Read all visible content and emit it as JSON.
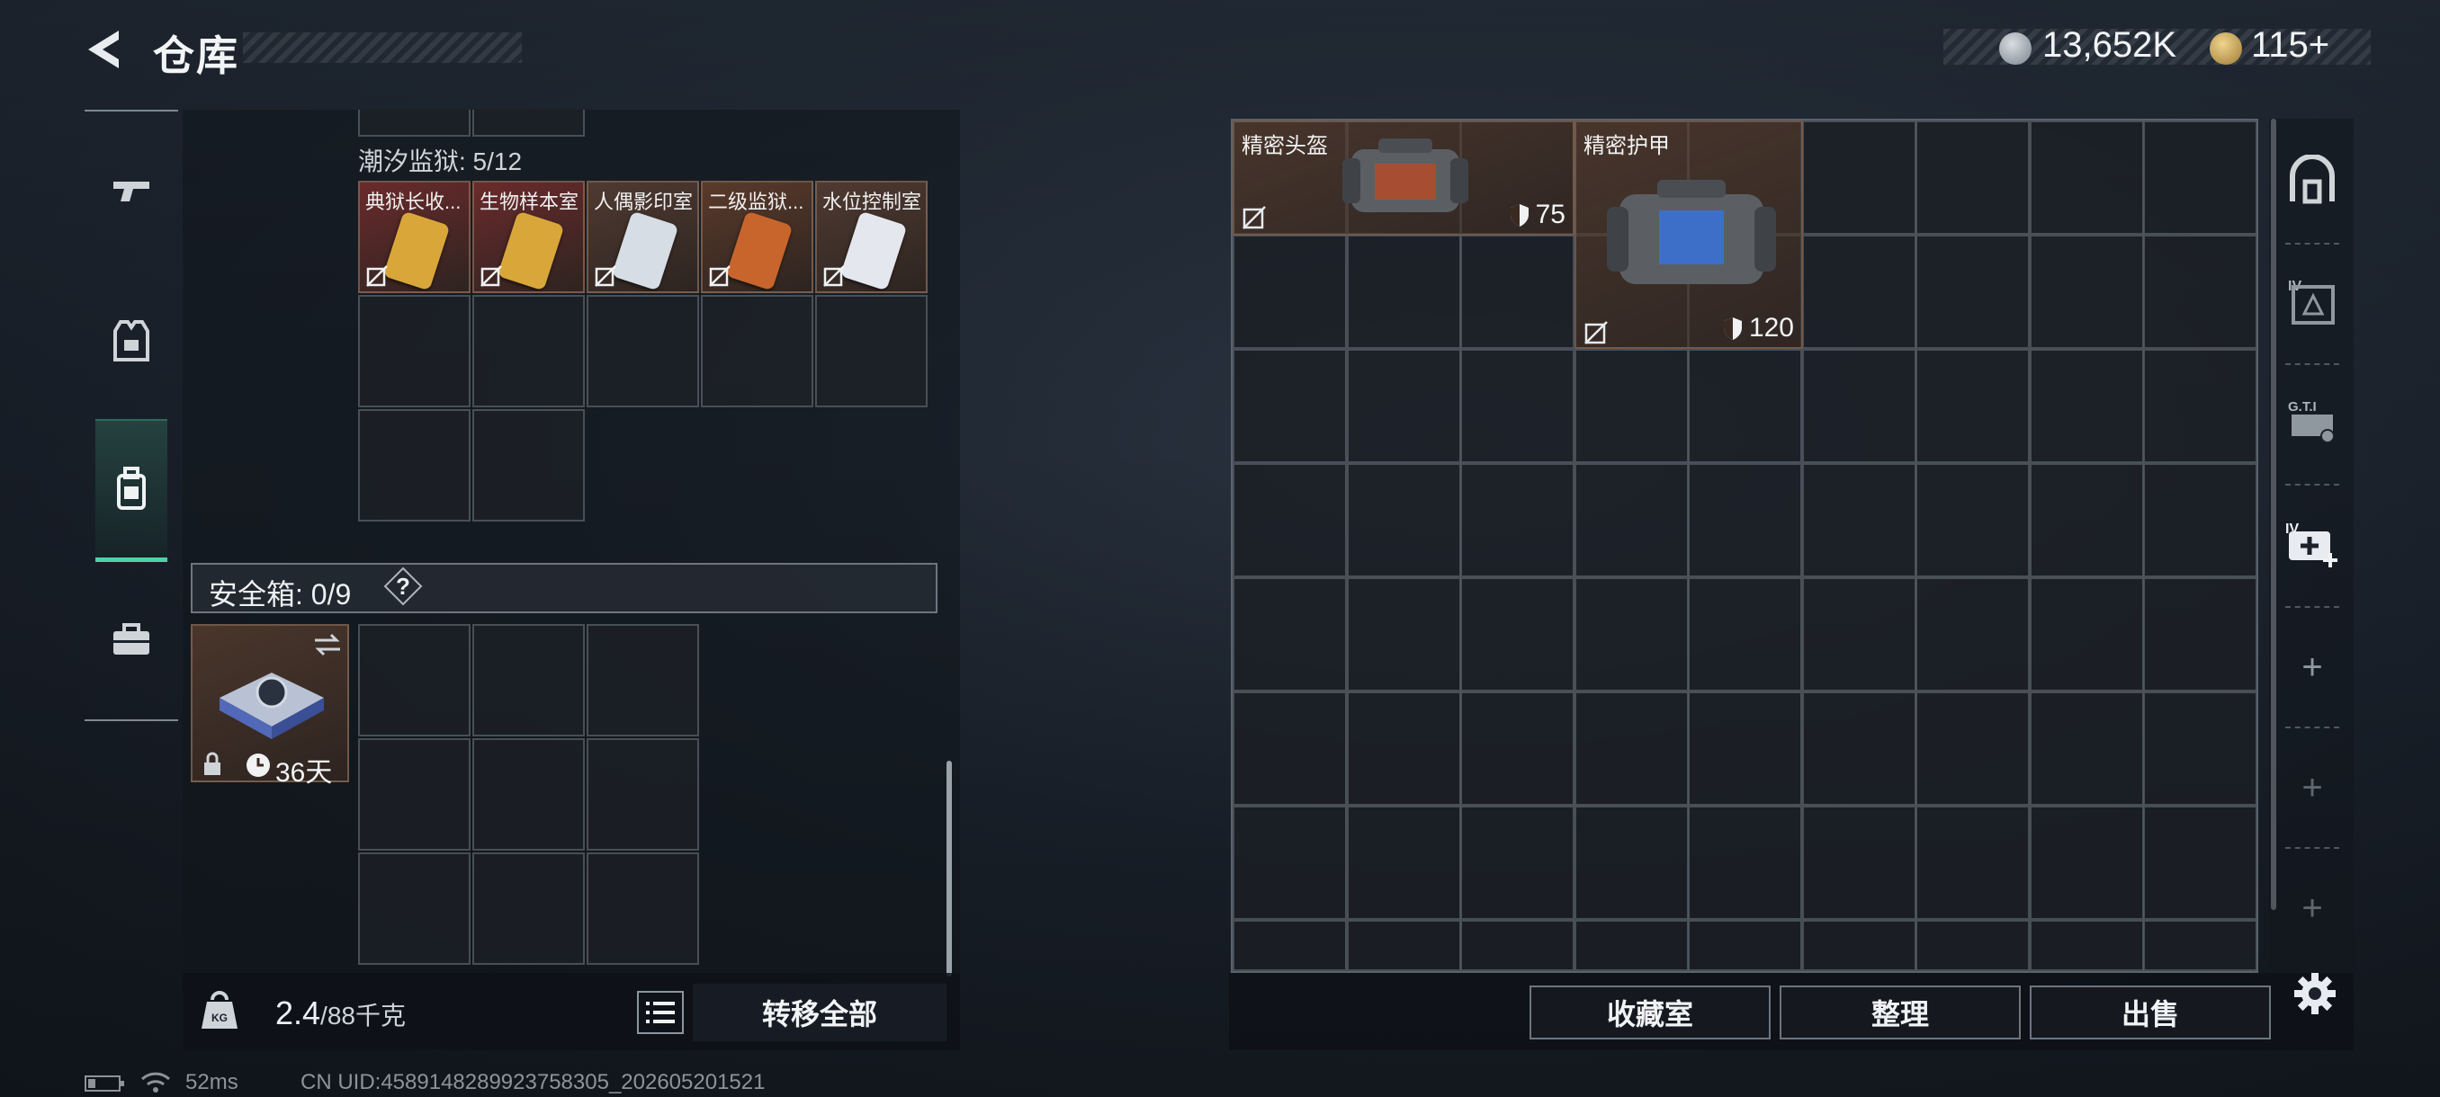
{
  "header": {
    "title": "仓库"
  },
  "currencies": [
    {
      "icon": "silver-coin-icon",
      "value": "13,652K"
    },
    {
      "icon": "gold-coin-icon",
      "value": "115+"
    }
  ],
  "left": {
    "section_label": "潮汐监狱: 5/12",
    "keycards": [
      {
        "name": "典狱长收...",
        "bg": "#6b2a2c",
        "card": "#d9a63a"
      },
      {
        "name": "生物样本室",
        "bg": "#6b2a2c",
        "card": "#d9a63a"
      },
      {
        "name": "人偶影印室",
        "bg": "#4f3a32",
        "card": "#d7dde4"
      },
      {
        "name": "二级监狱...",
        "bg": "#5a3a2a",
        "card": "#c7652c"
      },
      {
        "name": "水位控制室",
        "bg": "#4f3a32",
        "card": "#e4e7ee"
      }
    ],
    "safe_box": {
      "title": "安全箱: 0/9",
      "help": "?",
      "timer": "36天"
    },
    "weight": {
      "current": "2.4",
      "max": "/88千克"
    },
    "transfer_all": "转移全部"
  },
  "right": {
    "items": [
      {
        "name": "精密头盔",
        "durability": "75"
      },
      {
        "name": "精密护甲",
        "durability": "120"
      }
    ],
    "buttons": [
      "收藏室",
      "整理",
      "出售"
    ]
  },
  "status": {
    "ping": "52ms",
    "uid": "CN UID:4589148289923758305_202605201521"
  },
  "colors": {
    "accent": "#4fd1a7",
    "armor_bg": "#5a3e2d",
    "keycard_red": "#6b2a2c"
  }
}
